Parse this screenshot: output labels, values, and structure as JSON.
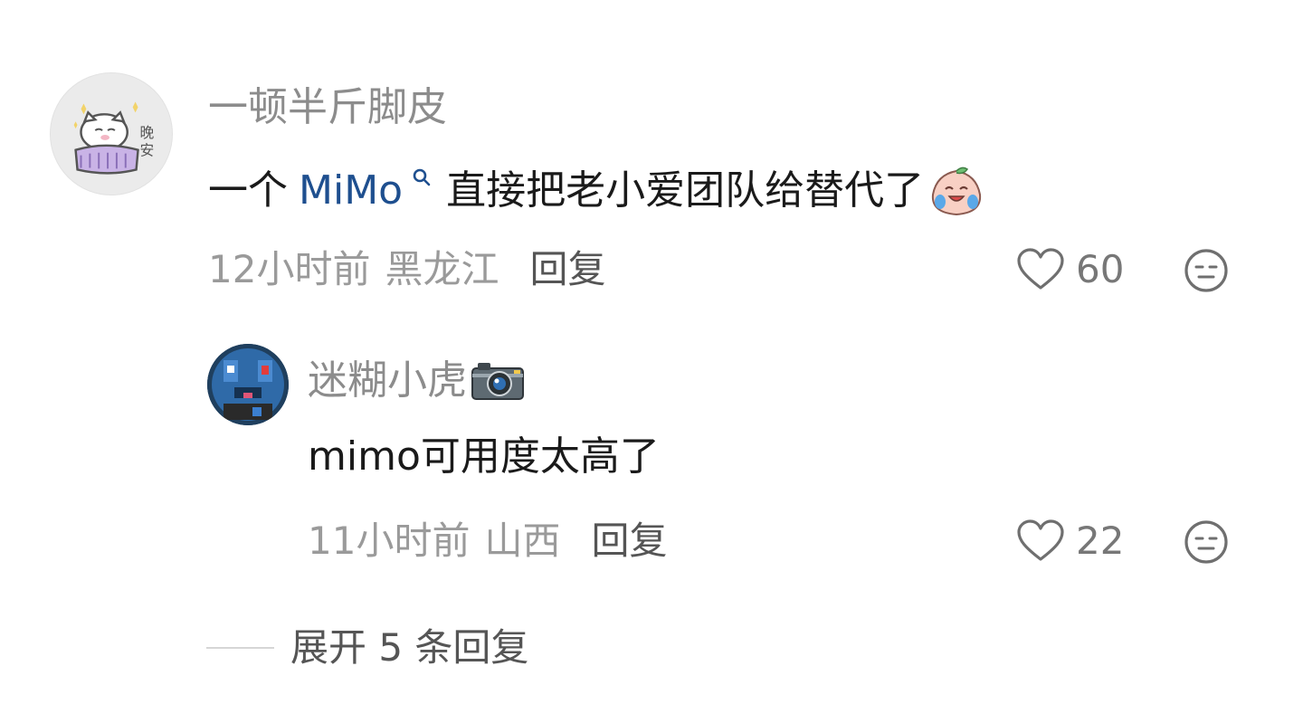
{
  "comment": {
    "username": "一顿半斤脚皮",
    "text_prefix": "一个",
    "mention": "MiMo",
    "text_suffix": "直接把老小爱团队给替代了",
    "time": "12小时前",
    "location": "黑龙江",
    "reply_label": "回复",
    "likes": "60",
    "avatar_icon": "sleeping-cat-avatar",
    "emoji_icon": "crying-laughing-peach-emoji"
  },
  "reply": {
    "username": "迷糊小虎",
    "username_emoji": "camera-icon",
    "text": "mimo可用度太高了",
    "time": "11小时前",
    "location": "山西",
    "reply_label": "回复",
    "likes": "22",
    "avatar_icon": "pixel-creature-avatar"
  },
  "expand": {
    "label": "展开 5 条回复"
  },
  "colors": {
    "username": "#8c8c8c",
    "mention": "#1e4f8f",
    "text": "#1a1a1a",
    "meta": "#9a9a9a"
  }
}
